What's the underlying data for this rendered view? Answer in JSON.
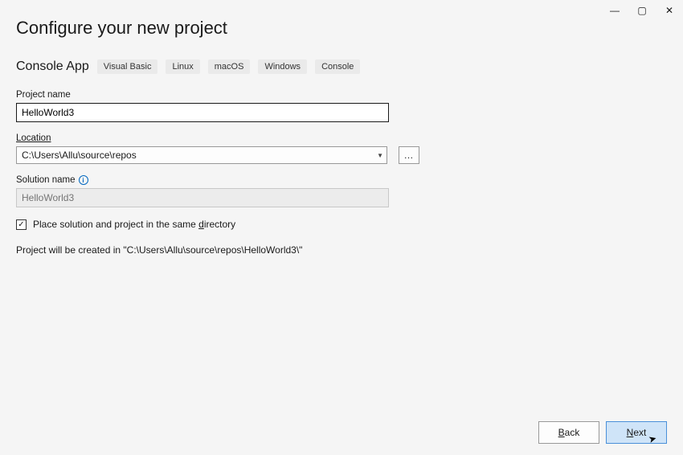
{
  "titlebar": {
    "minimize_glyph": "—",
    "maximize_glyph": "▢",
    "close_glyph": "✕"
  },
  "header": {
    "title": "Configure your new project",
    "template_name": "Console App",
    "tags": [
      "Visual Basic",
      "Linux",
      "macOS",
      "Windows",
      "Console"
    ]
  },
  "form": {
    "project_name_label": "Project name",
    "project_name_value": "HelloWorld3",
    "location_label": "Location",
    "location_value": "C:\\Users\\Allu\\source\\repos",
    "browse_glyph": "…",
    "solution_name_label": "Solution name",
    "solution_name_placeholder": "HelloWorld3",
    "info_glyph": "i",
    "checkbox_checked_glyph": "✓",
    "checkbox_label_pre": "Place solution and project in the same ",
    "checkbox_label_ul": "d",
    "checkbox_label_post": "irectory",
    "summary_text": "Project will be created in \"C:\\Users\\Allu\\source\\repos\\HelloWorld3\\\""
  },
  "footer": {
    "back_ul": "B",
    "back_rest": "ack",
    "next_ul": "N",
    "next_rest": "ext"
  }
}
